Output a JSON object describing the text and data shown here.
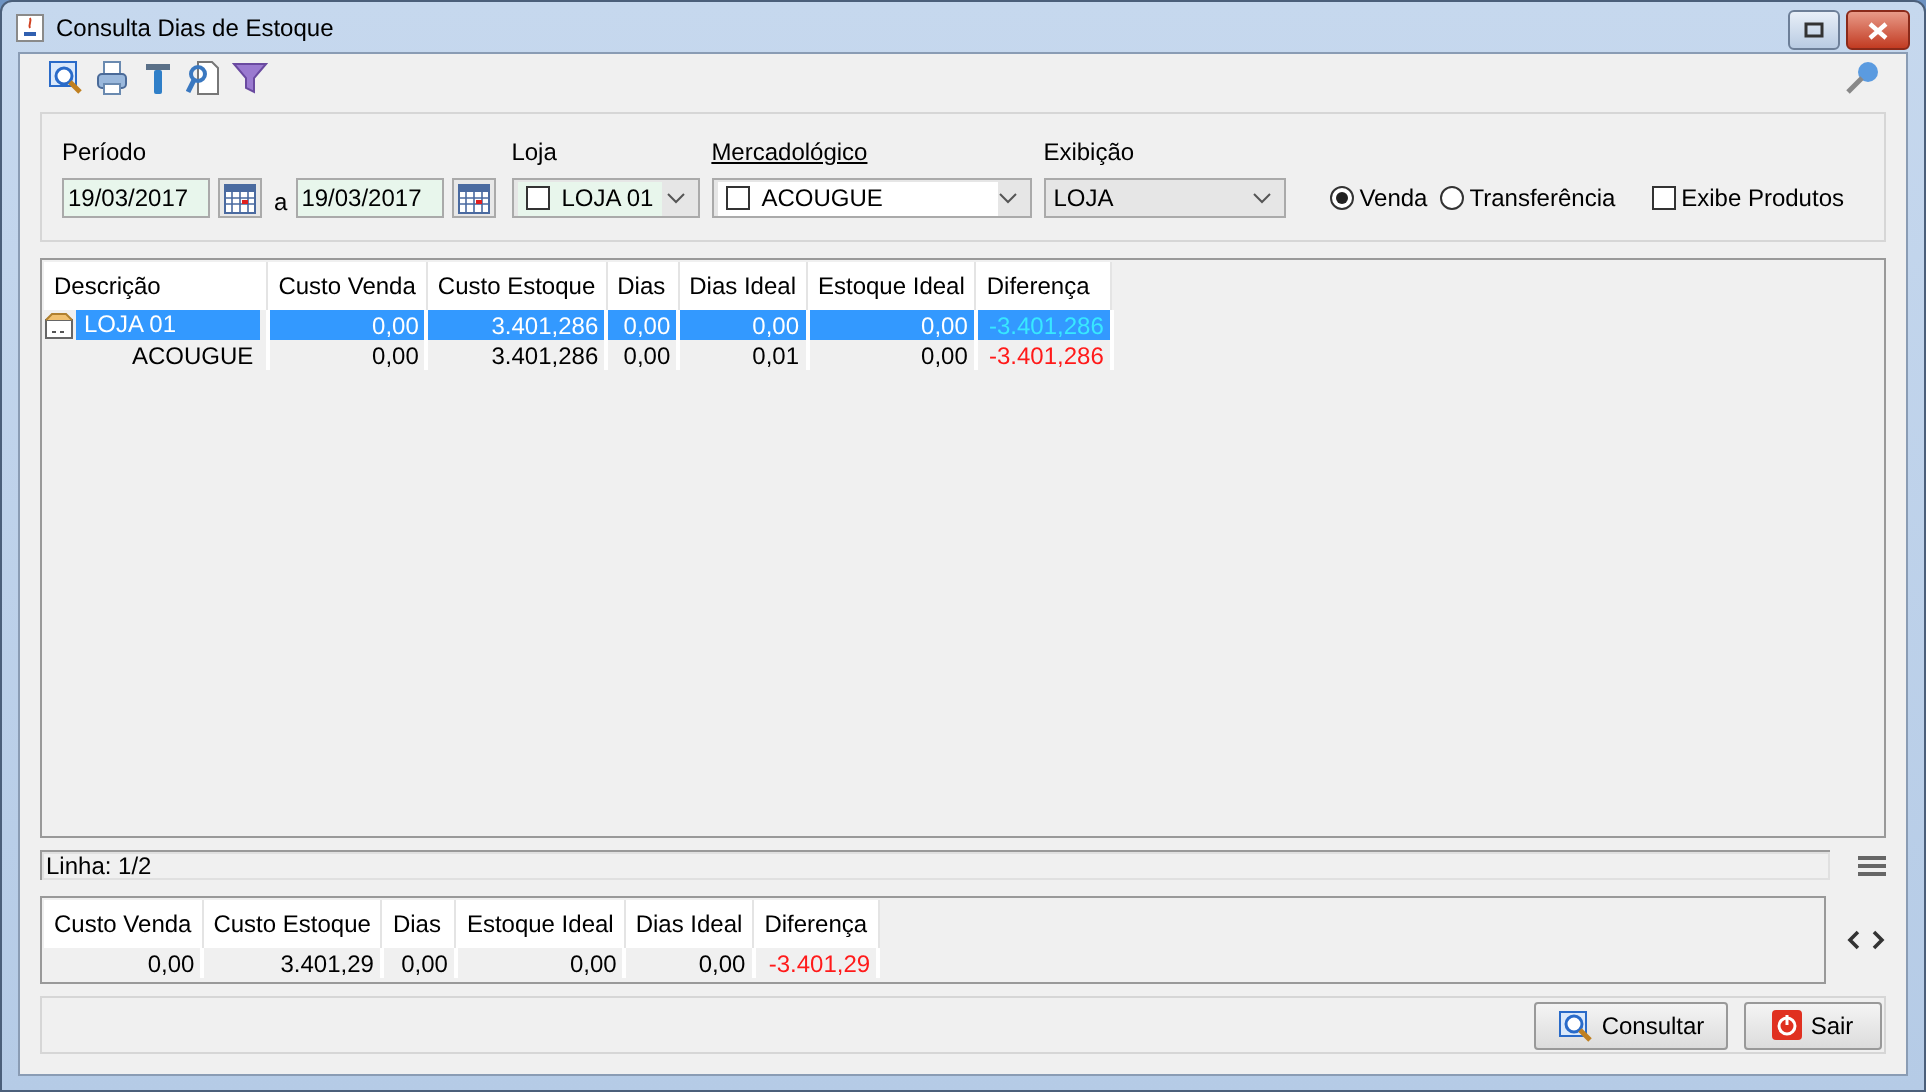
{
  "window": {
    "title": "Consulta Dias de Estoque"
  },
  "filters": {
    "periodo_label": "Período",
    "date_from": "19/03/2017",
    "separator": "a",
    "date_to": "19/03/2017",
    "loja": {
      "label": "Loja",
      "value": "LOJA 01",
      "checked": false
    },
    "mercadologico": {
      "label": "Mercadológico",
      "value": "ACOUGUE",
      "checked": false
    },
    "exibicao": {
      "label": "Exibição",
      "value": "LOJA"
    },
    "radios": [
      {
        "label": "Venda",
        "selected": true
      },
      {
        "label": "Transferência",
        "selected": false
      }
    ],
    "exibe_produtos": {
      "label": "Exibe Produtos",
      "checked": false
    }
  },
  "table": {
    "columns": [
      "Descrição",
      "Custo Venda",
      "Custo Estoque",
      "Dias",
      "Dias Ideal",
      "Estoque Ideal",
      "Diferença"
    ],
    "rows": [
      {
        "cells": [
          "LOJA 01",
          "0,00",
          "3.401,286",
          "0,00",
          "0,00",
          "0,00",
          "-3.401,286"
        ],
        "selected": true,
        "children": [
          {
            "cells": [
              "ACOUGUE",
              "0,00",
              "3.401,286",
              "0,00",
              "0,01",
              "0,00",
              "-3.401,286"
            ],
            "selected": false
          }
        ]
      }
    ]
  },
  "status_bar": "Linha: 1/2",
  "totals": {
    "columns": [
      "Custo Venda",
      "Custo Estoque",
      "Dias",
      "Estoque Ideal",
      "Dias Ideal",
      "Diferença"
    ],
    "values": [
      "0,00",
      "3.401,29",
      "0,00",
      "0,00",
      "0,00",
      "-3.401,29"
    ]
  },
  "buttons": [
    {
      "label": "Consultar",
      "kind": "search"
    },
    {
      "label": "Sair",
      "kind": "exit"
    }
  ]
}
